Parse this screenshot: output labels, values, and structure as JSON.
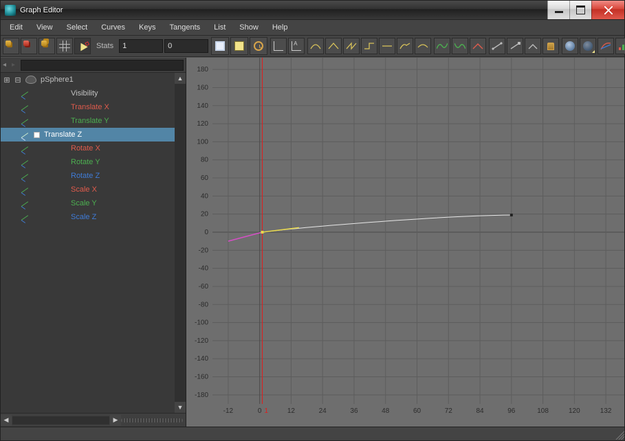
{
  "window": {
    "title": "Graph Editor"
  },
  "menu": [
    "Edit",
    "View",
    "Select",
    "Curves",
    "Keys",
    "Tangents",
    "List",
    "Show",
    "Help"
  ],
  "stats": {
    "label": "Stats",
    "frame": "1",
    "value": "0"
  },
  "outliner": {
    "expand": "⊞",
    "collapse": "⊟",
    "node": "pSphere1",
    "channels": [
      {
        "label": "Visibility",
        "color": "default"
      },
      {
        "label": "Translate X",
        "color": "red"
      },
      {
        "label": "Translate Y",
        "color": "green"
      },
      {
        "label": "Translate Z",
        "color": "default",
        "selected": true
      },
      {
        "label": "Rotate X",
        "color": "red"
      },
      {
        "label": "Rotate Y",
        "color": "green"
      },
      {
        "label": "Rotate Z",
        "color": "blue"
      },
      {
        "label": "Scale X",
        "color": "red"
      },
      {
        "label": "Scale Y",
        "color": "green"
      },
      {
        "label": "Scale Z",
        "color": "blue"
      }
    ]
  },
  "chart_data": {
    "type": "line",
    "title": "",
    "xlabel": "",
    "ylabel": "",
    "xlim": [
      -18,
      138
    ],
    "ylim": [
      -190,
      190
    ],
    "x_ticks": [
      -12,
      0,
      12,
      24,
      36,
      48,
      60,
      72,
      84,
      96,
      108,
      120,
      132
    ],
    "y_ticks": [
      -180,
      -160,
      -140,
      -120,
      -100,
      -80,
      -60,
      -40,
      -20,
      0,
      20,
      40,
      60,
      80,
      100,
      120,
      140,
      160,
      180
    ],
    "current_time": 1,
    "series": [
      {
        "name": "Translate Z",
        "selected_key": 0,
        "keys": [
          {
            "x": 1,
            "y": 0,
            "in_handle": [
              -13,
              -10
            ],
            "out_handle": [
              14,
              5
            ]
          },
          {
            "x": 96,
            "y": 19
          }
        ]
      }
    ]
  }
}
